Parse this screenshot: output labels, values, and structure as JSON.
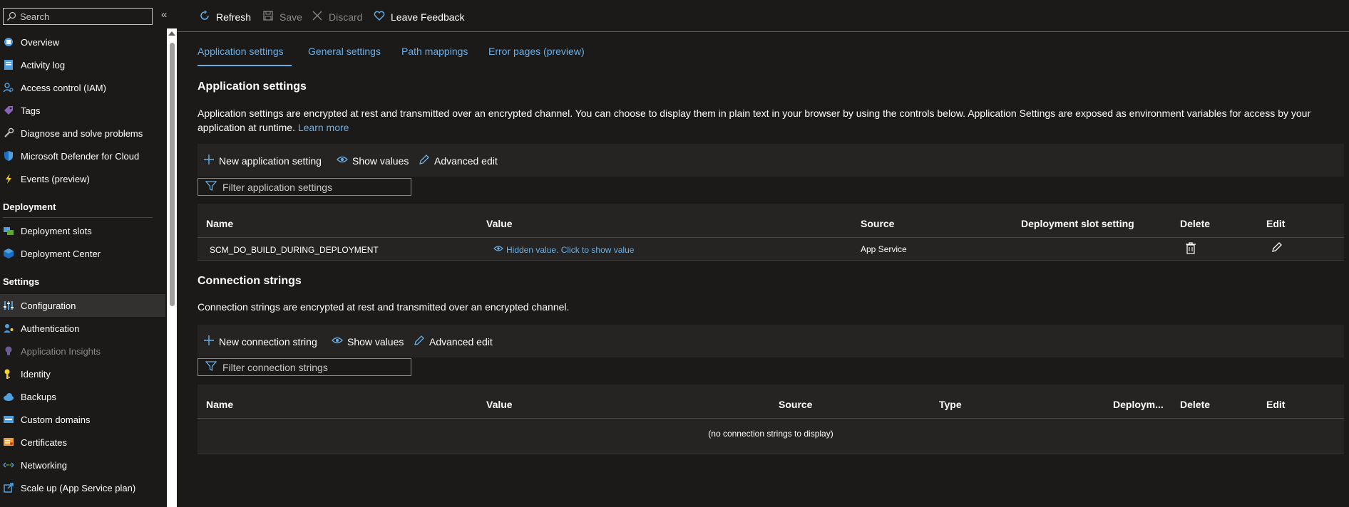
{
  "sidebar": {
    "search_placeholder": "Search",
    "collapse": "«",
    "items_top": [
      {
        "label": "Overview",
        "icon": "overview-icon"
      },
      {
        "label": "Activity log",
        "icon": "activity-log-icon"
      },
      {
        "label": "Access control (IAM)",
        "icon": "people-icon"
      },
      {
        "label": "Tags",
        "icon": "tag-icon"
      },
      {
        "label": "Diagnose and solve problems",
        "icon": "wrench-icon"
      },
      {
        "label": "Microsoft Defender for Cloud",
        "icon": "shield-icon"
      },
      {
        "label": "Events (preview)",
        "icon": "lightning-icon"
      }
    ],
    "section_deployment": "Deployment",
    "items_deployment": [
      {
        "label": "Deployment slots",
        "icon": "slots-icon"
      },
      {
        "label": "Deployment Center",
        "icon": "cube-icon"
      }
    ],
    "section_settings": "Settings",
    "items_settings": [
      {
        "label": "Configuration",
        "icon": "sliders-icon",
        "selected": true
      },
      {
        "label": "Authentication",
        "icon": "person-key-icon"
      },
      {
        "label": "Application Insights",
        "icon": "lightbulb-icon",
        "disabled": true
      },
      {
        "label": "Identity",
        "icon": "key-icon"
      },
      {
        "label": "Backups",
        "icon": "cloud-icon"
      },
      {
        "label": "Custom domains",
        "icon": "domain-icon"
      },
      {
        "label": "Certificates",
        "icon": "certificate-icon"
      },
      {
        "label": "Networking",
        "icon": "network-icon"
      },
      {
        "label": "Scale up (App Service plan)",
        "icon": "scale-up-icon"
      }
    ]
  },
  "toolbar": {
    "refresh": "Refresh",
    "save": "Save",
    "discard": "Discard",
    "feedback": "Leave Feedback"
  },
  "tabs": [
    "Application settings",
    "General settings",
    "Path mappings",
    "Error pages (preview)"
  ],
  "app_settings": {
    "title": "Application settings",
    "description_line1": "Application settings are encrypted at rest and transmitted over an encrypted channel. You can choose to display them in plain text in your browser by using the controls below. Application Settings are exposed as environment variables for access by your",
    "description_line2": "application at runtime.",
    "learn_more": "Learn more",
    "new_label": "New application setting",
    "show_values": "Show values",
    "advanced_edit": "Advanced edit",
    "filter_placeholder": "Filter application settings",
    "columns": [
      "Name",
      "Value",
      "Source",
      "Deployment slot setting",
      "Delete",
      "Edit"
    ],
    "rows": [
      {
        "name": "SCM_DO_BUILD_DURING_DEPLOYMENT",
        "value": "Hidden value. Click to show value",
        "source": "App Service",
        "slot_setting": ""
      }
    ]
  },
  "connection_strings": {
    "title": "Connection strings",
    "description": "Connection strings are encrypted at rest and transmitted over an encrypted channel.",
    "new_label": "New connection string",
    "show_values": "Show values",
    "advanced_edit": "Advanced edit",
    "filter_placeholder": "Filter connection strings",
    "columns": [
      "Name",
      "Value",
      "Source",
      "Type",
      "Deploym...",
      "Delete",
      "Edit"
    ],
    "empty": "(no connection strings to display)"
  },
  "colors": {
    "accent": "#69afe5",
    "background": "#1b1a19",
    "panel": "#252423"
  }
}
